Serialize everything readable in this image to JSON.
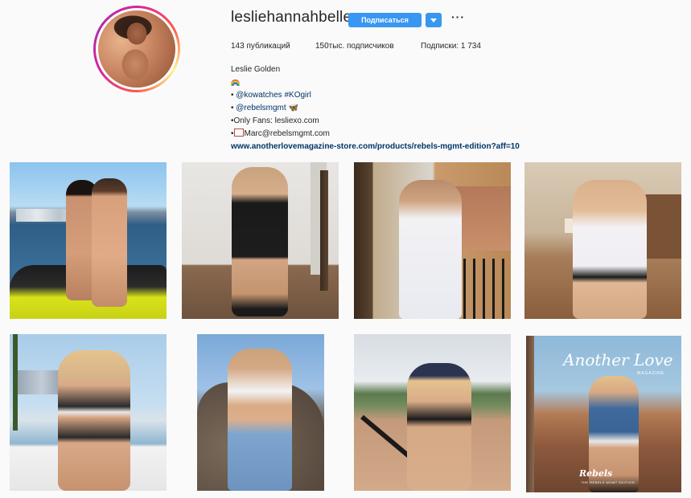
{
  "profile": {
    "username": "lesliehannahbelle",
    "follow_label": "Подписаться",
    "more_label": "···",
    "posts_count": "143",
    "posts_label": "публикаций",
    "followers_count": "150тыс.",
    "followers_label": "подписчиков",
    "following_label": "Подписки:",
    "following_count": "1 734"
  },
  "bio": {
    "name": "Leslie Golden",
    "line2_emoji": "rainbow-emoji",
    "line3_prefix": "• ",
    "line3_mention": "@kowatches",
    "line3_hashtag": "#KOgirl",
    "line4_prefix": "• ",
    "line4_mention": "@rebelsmgmt",
    "line4_emoji": "🦋",
    "line5": "•Only Fans: lesliexo.com",
    "line6_prefix": "•",
    "line6_text": "Marc@rebelsmgmt.com",
    "website": "www.anotherlovemagazine-store.com/products/rebels-mgmt-edition?aff=10"
  },
  "posts": [
    {
      "id": "post-1",
      "alt": "jetski"
    },
    {
      "id": "post-2",
      "alt": "black-bodysuit"
    },
    {
      "id": "post-3",
      "alt": "balcony-robe"
    },
    {
      "id": "post-4",
      "alt": "living-room-shirt"
    },
    {
      "id": "post-5",
      "alt": "checkered-bikini"
    },
    {
      "id": "post-6",
      "alt": "rocks-denim"
    },
    {
      "id": "post-7",
      "alt": "baseball-field"
    },
    {
      "id": "post-8",
      "alt": "magazine-cover"
    }
  ],
  "magazine": {
    "title": "Another Love",
    "subtitle": "MAGAZINE",
    "brand": "Rebels",
    "tagline": "THE REBELS MGMT EDITION"
  },
  "colors": {
    "accent": "#3897f0",
    "link": "#003569",
    "background": "#fafafa"
  }
}
